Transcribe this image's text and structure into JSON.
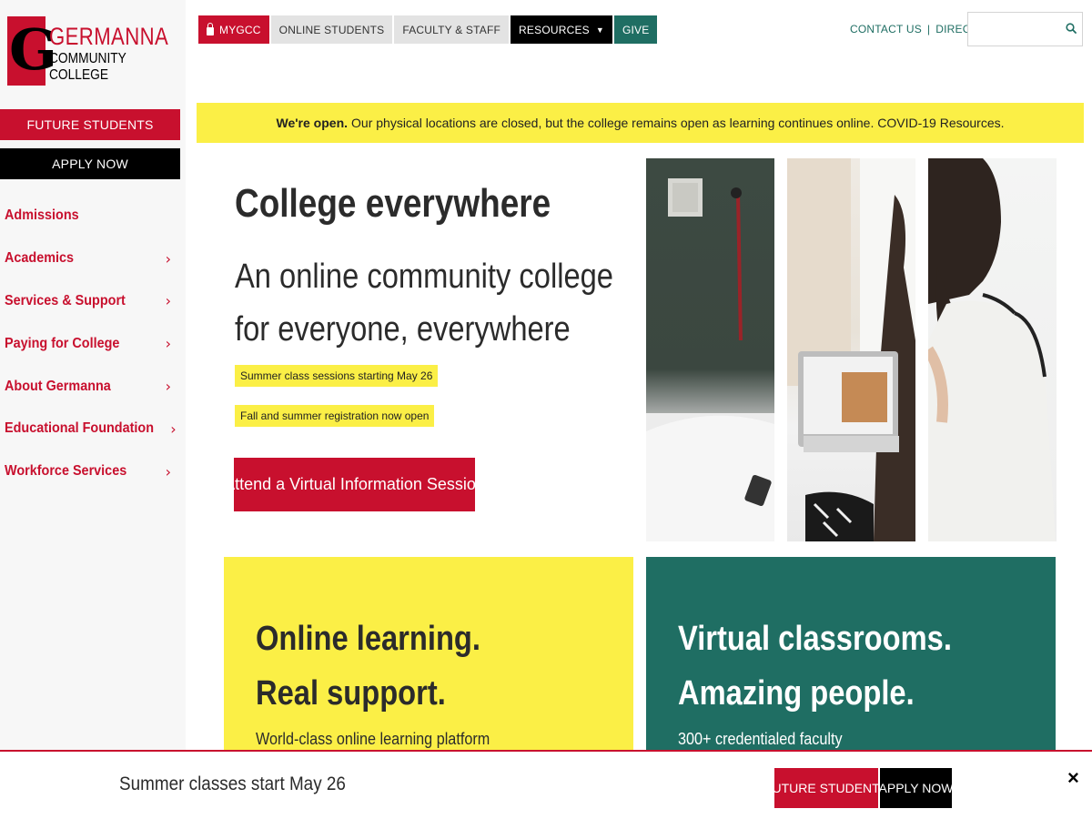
{
  "logo": {
    "mark_letter": "G",
    "name": "GERMANNA",
    "sub": "COMMUNITY COLLEGE"
  },
  "sidebar": {
    "future_students": "FUTURE STUDENTS",
    "apply_now": "APPLY NOW",
    "items": [
      {
        "label": "Admissions",
        "chevron": ""
      },
      {
        "label": "Academics",
        "chevron": "›"
      },
      {
        "label": "Services & Support",
        "chevron": "›"
      },
      {
        "label": "Paying for College",
        "chevron": "›"
      },
      {
        "label": "About Germanna",
        "chevron": "›"
      },
      {
        "label": "Educational Foundation",
        "chevron": "›"
      },
      {
        "label": "Workforce Services",
        "chevron": "›"
      }
    ]
  },
  "topnav": {
    "mygcc": "MYGCC",
    "online_students": "ONLINE STUDENTS",
    "faculty_staff": "FACULTY & STAFF",
    "resources": "RESOURCES",
    "give": "GIVE"
  },
  "util": {
    "contact": "CONTACT US",
    "separator": "|",
    "directory": "DIRECTORY"
  },
  "search": {
    "placeholder": "",
    "icon": "search-icon"
  },
  "alert": {
    "bold": "We're open.",
    "text": "Our physical locations are closed, but the college remains open as learning continues online. COVID-19 Resources."
  },
  "hero": {
    "title": "College everywhere",
    "subtitle": "An online community college for everyone, everywhere",
    "pill1": "Summer class sessions starting May 26",
    "pill2": "Fall and summer registration now open",
    "cta": "Attend a Virtual Information Session"
  },
  "cards": {
    "left": {
      "line1": "Online learning.",
      "line2": "Real support.",
      "desc": "World-class online learning platform"
    },
    "right": {
      "line1": "Virtual classrooms.",
      "line2": "Amazing people.",
      "desc": "300+ credentialed faculty"
    }
  },
  "bottom": {
    "text": "Summer classes start May 26",
    "future_students": "FUTURE STUDENTS",
    "apply_now": "APPLY NOW",
    "close": "×"
  },
  "colors": {
    "brand_red": "#c8102e",
    "teal": "#1f6e63",
    "yellow": "#fbef46",
    "black": "#000000"
  }
}
